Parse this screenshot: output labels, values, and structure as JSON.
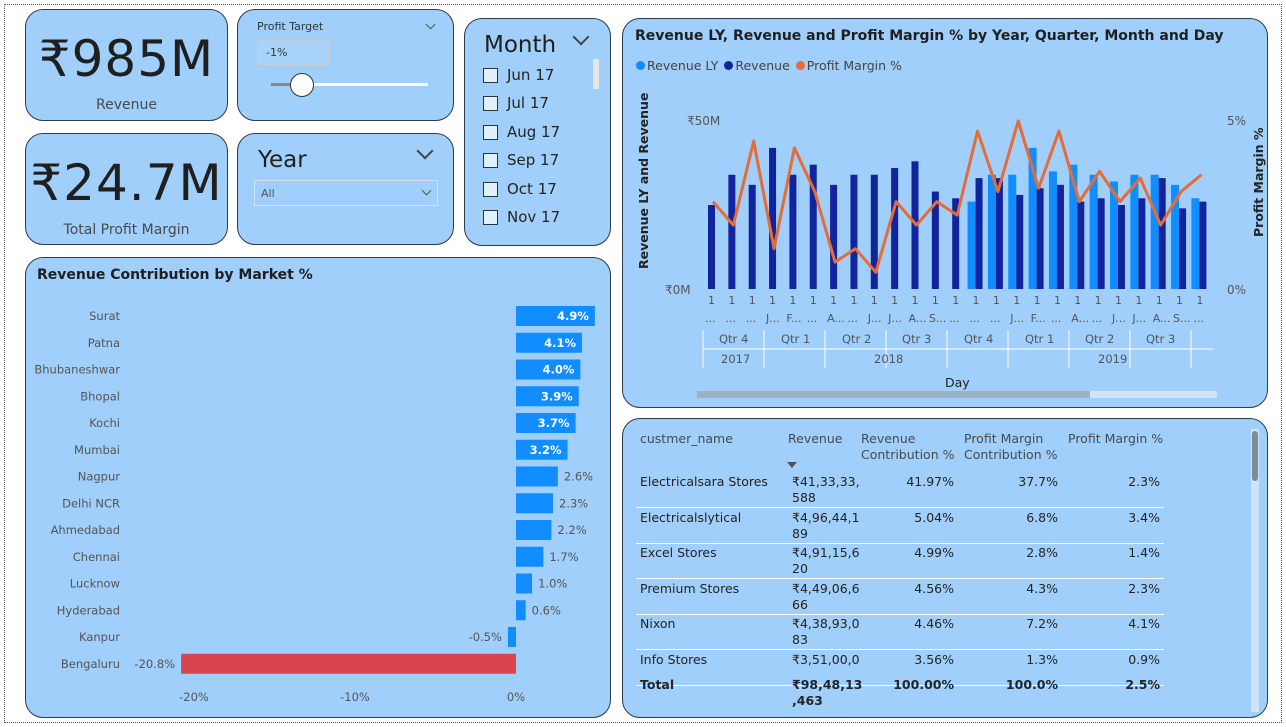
{
  "kpis": {
    "revenue": {
      "value": "₹985M",
      "label": "Revenue"
    },
    "profit": {
      "value": "₹24.7M",
      "label": "Total Profit Margin"
    }
  },
  "profit_target": {
    "title": "Profit Target",
    "value": "-1%",
    "slider_fraction": 0.2
  },
  "year_slicer": {
    "title": "Year",
    "selected": "All"
  },
  "month_slicer": {
    "title": "Month",
    "items": [
      "Jun 17",
      "Jul 17",
      "Aug 17",
      "Sep 17",
      "Oct 17",
      "Nov 17"
    ]
  },
  "combo_chart": {
    "title": "Revenue LY, Revenue and Profit Margin % by Year, Quarter, Month and Day",
    "legend": [
      {
        "name": "Revenue LY",
        "color": "#118dff"
      },
      {
        "name": "Revenue",
        "color": "#12239e"
      },
      {
        "name": "Profit Margin %",
        "color": "#e66c37"
      }
    ],
    "y_left_label": "Revenue LY and Revenue",
    "y_right_label": "Profit Margin %",
    "y_left_ticks": [
      "₹50M",
      "₹0M"
    ],
    "y_right_ticks": [
      "5%",
      "0%"
    ],
    "x_title": "Day",
    "x_day_labels": [
      "1",
      "1",
      "1",
      "1",
      "1",
      "1",
      "1",
      "1",
      "1",
      "1",
      "1",
      "1",
      "1",
      "1",
      "1",
      "1",
      "1",
      "1",
      "1",
      "1",
      "1",
      "1",
      "1",
      "1",
      "1"
    ],
    "x_month_labels": [
      "...",
      "...",
      "...",
      "J...",
      "F...",
      "...",
      "A...",
      "...",
      "J...",
      "J...",
      "A...",
      "S...",
      "...",
      "...",
      "...",
      "J...",
      "F...",
      "...",
      "A...",
      "...",
      "J...",
      "J...",
      "A...",
      "S...",
      "..."
    ],
    "quarters": [
      "Qtr 4",
      "Qtr 1",
      "Qtr 2",
      "Qtr 3",
      "Qtr 4",
      "Qtr 1",
      "Qtr 2",
      "Qtr 3"
    ],
    "years": [
      "2017",
      "2018",
      "2019"
    ]
  },
  "chart_data": [
    {
      "type": "bar",
      "title": "Revenue LY, Revenue and Profit Margin % by Year, Quarter, Month and Day",
      "xlabel": "Day",
      "ylabel": "Revenue LY and Revenue",
      "y2label": "Profit Margin %",
      "ylim": [
        0,
        50
      ],
      "y2lim": [
        0,
        5
      ],
      "categories_count": 25,
      "series": [
        {
          "name": "Revenue LY",
          "values": [
            null,
            null,
            null,
            null,
            null,
            null,
            null,
            null,
            null,
            null,
            null,
            null,
            null,
            26,
            34,
            34,
            42,
            35,
            37,
            34,
            32,
            34,
            34,
            31,
            27
          ]
        },
        {
          "name": "Revenue",
          "values": [
            25,
            34,
            31,
            42,
            34,
            37,
            31,
            34,
            34,
            36,
            38,
            29,
            27,
            33,
            33,
            28,
            30,
            31,
            26,
            27,
            25,
            27,
            33,
            24,
            26
          ]
        },
        {
          "name": "Profit Margin %",
          "values": [
            2.6,
            1.9,
            4.4,
            1.2,
            4.2,
            2.9,
            0.8,
            1.2,
            0.5,
            2.6,
            1.9,
            2.6,
            2.2,
            4.7,
            2.9,
            5.0,
            3.0,
            4.7,
            2.6,
            3.5,
            2.6,
            3.3,
            1.9,
            2.9,
            3.4
          ]
        }
      ]
    },
    {
      "type": "bar",
      "title": "Revenue Contribution by Market %",
      "categories": [
        "Surat",
        "Patna",
        "Bhubaneshwar",
        "Bhopal",
        "Kochi",
        "Mumbai",
        "Nagpur",
        "Delhi NCR",
        "Ahmedabad",
        "Chennai",
        "Lucknow",
        "Hyderabad",
        "Kanpur",
        "Bengaluru"
      ],
      "values": [
        4.9,
        4.1,
        4.0,
        3.9,
        3.7,
        3.2,
        2.6,
        2.3,
        2.2,
        1.7,
        1.0,
        0.6,
        -0.5,
        -20.8
      ],
      "value_labels": [
        "4.9%",
        "4.1%",
        "4.0%",
        "3.9%",
        "3.7%",
        "3.2%",
        "2.6%",
        "2.3%",
        "2.2%",
        "1.7%",
        "1.0%",
        "0.6%",
        "-0.5%",
        "-20.8%"
      ],
      "x_ticks": [
        "-20%",
        "-10%",
        "0%"
      ],
      "xlim": [
        -21.3,
        5.2
      ]
    }
  ],
  "market_chart": {
    "title": "Revenue Contribution by Market %",
    "bar_color": "#118dff",
    "highlight_color": "#d9444f"
  },
  "table": {
    "headers": [
      "custmer_name",
      "Revenue",
      "Revenue Contribution %",
      "Profit Margin Contribution %",
      "Profit Margin %"
    ],
    "rows": [
      {
        "name": "Electricalsara Stores",
        "revenue": "₹41,33,33,\n588",
        "rev_contrib": "41.97%",
        "pm_contrib": "37.7%",
        "pm": "2.3%"
      },
      {
        "name": "Electricalslytical",
        "revenue": "₹4,96,44,1\n89",
        "rev_contrib": "5.04%",
        "pm_contrib": "6.8%",
        "pm": "3.4%"
      },
      {
        "name": "Excel Stores",
        "revenue": "₹4,91,15,6\n20",
        "rev_contrib": "4.99%",
        "pm_contrib": "2.8%",
        "pm": "1.4%"
      },
      {
        "name": "Premium Stores",
        "revenue": "₹4,49,06,6\n66",
        "rev_contrib": "4.56%",
        "pm_contrib": "4.3%",
        "pm": "2.3%"
      },
      {
        "name": "Nixon",
        "revenue": "₹4,38,93,0\n83",
        "rev_contrib": "4.46%",
        "pm_contrib": "7.2%",
        "pm": "4.1%"
      },
      {
        "name": "Info Stores",
        "revenue": "₹3,51,00,0",
        "rev_contrib": "3.56%",
        "pm_contrib": "1.3%",
        "pm": "0.9%"
      }
    ],
    "total": {
      "name": "Total",
      "revenue": "₹98,48,13\n,463",
      "rev_contrib": "100.00%",
      "pm_contrib": "100.0%",
      "pm": "2.5%"
    }
  }
}
